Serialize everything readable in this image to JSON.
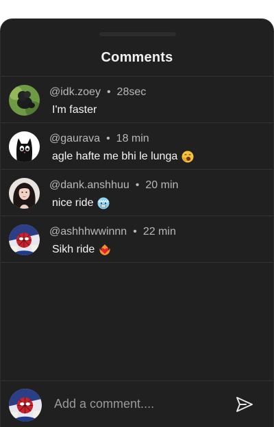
{
  "header": {
    "title": "Comments"
  },
  "comments": [
    {
      "username": "@idk.zoey",
      "time": "28sec",
      "text": "I'm faster",
      "emoji": ""
    },
    {
      "username": "@gaurava",
      "time": "18 min",
      "text": "agle hafte me bhi le lunga",
      "emoji": "yawning-face-icon"
    },
    {
      "username": "@dank.anshhuu",
      "time": "20 min",
      "text": "nice ride",
      "emoji": "cold-face-icon"
    },
    {
      "username": "@ashhhwwinnn",
      "time": "22 min",
      "text": "Sikh ride",
      "emoji": "heart-on-fire-icon"
    }
  ],
  "composer": {
    "placeholder": "Add a comment....",
    "send_icon": "send-icon"
  },
  "colors": {
    "background": "#202020",
    "text": "#f5f5f5",
    "muted": "#b9b9b9",
    "divider": "#333333"
  }
}
